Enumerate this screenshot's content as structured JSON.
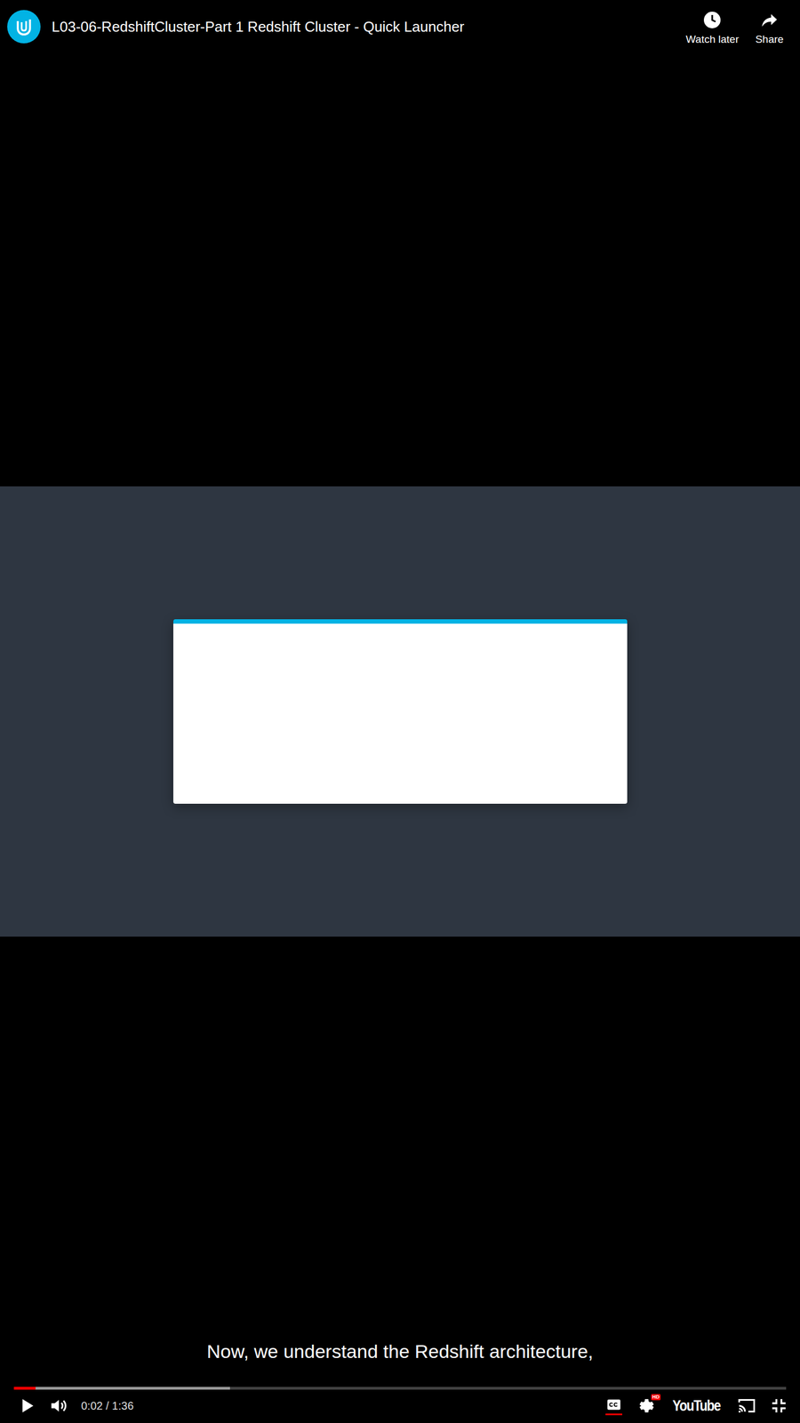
{
  "window": {
    "title": "L03-06-RedshiftCluster-Part 1 Redshift Cluster - Quick Launcher"
  },
  "top_actions": [
    {
      "label": "Watch later",
      "kind": "clock"
    },
    {
      "label": "Share",
      "kind": "share"
    }
  ],
  "caption": "Now, we understand the Redshift architecture,",
  "progress": {
    "level": 0.028,
    "buffered_level": 0.28
  },
  "playing": false,
  "time": "0:02 / 1:36",
  "captions_on": true,
  "settings_badge": "HD",
  "logo": "YouTube"
}
